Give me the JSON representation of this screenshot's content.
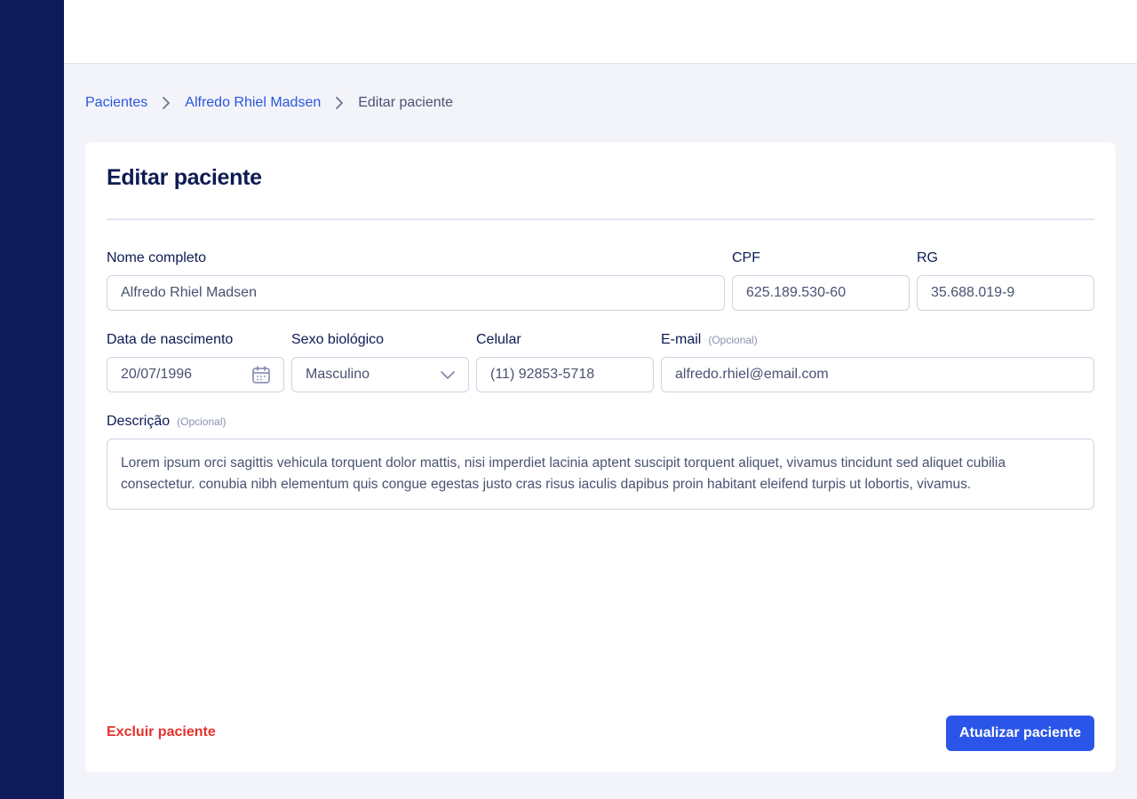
{
  "breadcrumb": {
    "items": [
      "Pacientes",
      "Alfredo Rhiel Madsen"
    ],
    "current": "Editar paciente"
  },
  "card": {
    "title": "Editar paciente"
  },
  "form": {
    "nome": {
      "label": "Nome completo",
      "value": "Alfredo Rhiel Madsen"
    },
    "cpf": {
      "label": "CPF",
      "value": "625.189.530-60"
    },
    "rg": {
      "label": "RG",
      "value": "35.688.019-9"
    },
    "nascimento": {
      "label": "Data de nascimento",
      "value": "20/07/1996",
      "icon": "calendar-icon"
    },
    "sexo": {
      "label": "Sexo biológico",
      "value": "Masculino",
      "icon": "chevron-down-icon"
    },
    "celular": {
      "label": "Celular",
      "value": "(11) 92853-5718"
    },
    "email": {
      "label": "E-mail",
      "optional": "(Opcional)",
      "value": "alfredo.rhiel@email.com"
    },
    "descricao": {
      "label": "Descrição",
      "optional": "(Opcional)",
      "value": "Lorem ipsum orci sagittis vehicula torquent dolor mattis, nisi imperdiet lacinia aptent suscipit torquent aliquet, vivamus tincidunt sed aliquet cubilia consectetur. conubia nibh elementum quis congue egestas justo cras risus iaculis dapibus proin habitant eleifend turpis ut lobortis, vivamus."
    }
  },
  "actions": {
    "delete_label": "Excluir paciente",
    "update_label": "Atualizar paciente"
  },
  "colors": {
    "sidebar": "#0d1b5a",
    "primary": "#2a55e8",
    "danger": "#e5322d",
    "text": "#0d1b52"
  }
}
